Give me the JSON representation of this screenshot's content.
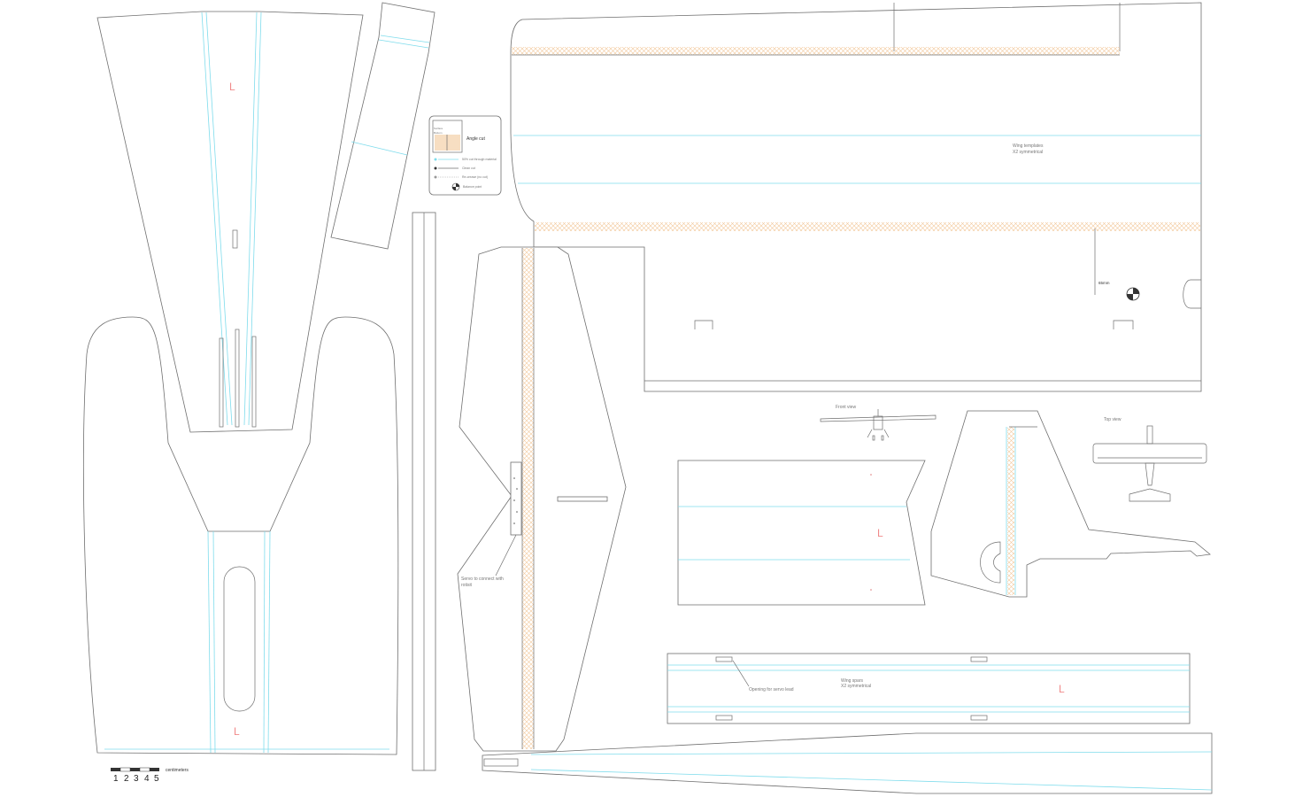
{
  "legend": {
    "title": "Angle cut",
    "swatch_caption_top": "Surface",
    "swatch_caption_bottom": "Bottom",
    "items": [
      {
        "icon": "fold-line-icon",
        "label": "50% cut through material"
      },
      {
        "icon": "cut-line-icon",
        "label": "Clean cut"
      },
      {
        "icon": "score-line-icon",
        "label": "Re-crease (no cut)"
      },
      {
        "icon": "balance-point-icon",
        "label": "Balance point"
      }
    ]
  },
  "wing": {
    "templates_label_line1": "Wing templates",
    "templates_label_line2": "X2 symmetrical",
    "balance_label": "65mm",
    "spars_label_line1": "Wing spars",
    "spars_label_line2": "X2 symmetrical",
    "servo_opening_label": "Opening for servo lead"
  },
  "tail": {
    "servo_note_line1": "Servo to connect with",
    "servo_note_line2": "rotisit"
  },
  "views": {
    "front": "Front view",
    "top": "Top view"
  },
  "part_marks": {
    "left_mark": "L"
  },
  "scale": {
    "ticks": [
      "1",
      "2",
      "3",
      "4",
      "5"
    ],
    "unit": "centimeters"
  },
  "colors": {
    "outline": "#6f6f6f",
    "fold_line": "#7fdcec",
    "hatch": "#f2c89a",
    "part_mark": "#f08a8a"
  }
}
